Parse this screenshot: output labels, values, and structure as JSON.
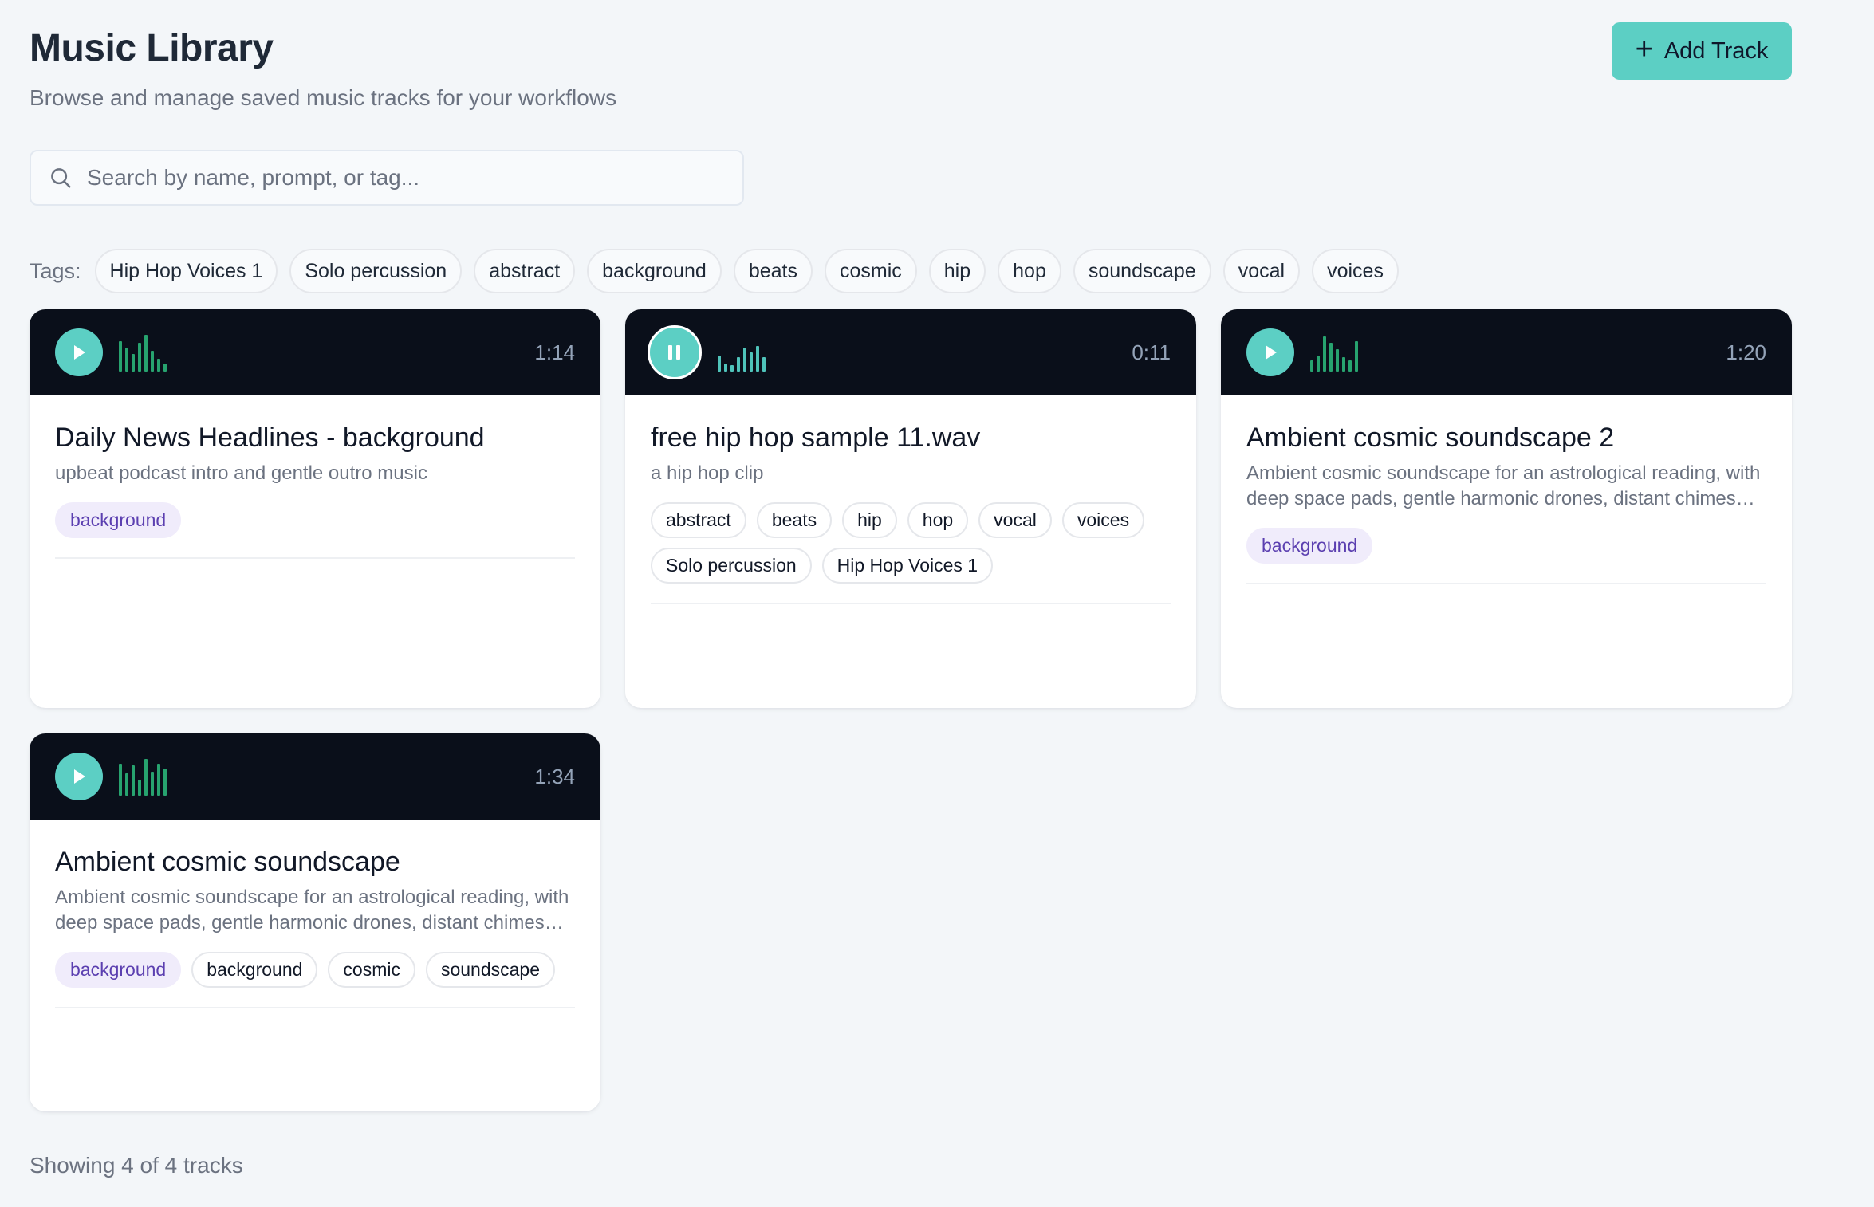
{
  "header": {
    "title": "Music Library",
    "subtitle": "Browse and manage saved music tracks for your workflows",
    "add_label": "Add Track"
  },
  "search": {
    "placeholder": "Search by name, prompt, or tag...",
    "value": ""
  },
  "tags": {
    "label": "Tags:",
    "items": [
      "Hip Hop Voices 1",
      "Solo percussion",
      "abstract",
      "background",
      "beats",
      "cosmic",
      "hip",
      "hop",
      "soundscape",
      "vocal",
      "voices"
    ]
  },
  "tracks": [
    {
      "name": "Daily News Headlines - background",
      "description": "upbeat podcast intro and gentle outro music",
      "duration": "1:14",
      "state": "paused",
      "primary_tag": "background",
      "tags": []
    },
    {
      "name": "free hip hop sample 11.wav",
      "description": "a hip hop clip",
      "duration": "0:11",
      "state": "playing",
      "primary_tag": "",
      "tags": [
        "abstract",
        "beats",
        "hip",
        "hop",
        "vocal",
        "voices",
        "Solo percussion",
        "Hip Hop Voices 1"
      ]
    },
    {
      "name": "Ambient cosmic soundscape 2",
      "description": "Ambient cosmic soundscape for an astrological reading, with deep space pads, gentle harmonic drones, distant chimes and subtle shimmer",
      "duration": "1:20",
      "state": "paused",
      "primary_tag": "background",
      "tags": []
    },
    {
      "name": "Ambient cosmic soundscape",
      "description": "Ambient cosmic soundscape for an astrological reading, with deep space pads, gentle harmonic drones, distant chimes and subtle shimmer",
      "duration": "1:34",
      "state": "paused",
      "primary_tag": "background",
      "tags": [
        "background",
        "cosmic",
        "soundscape"
      ]
    }
  ],
  "footer": {
    "summary": "Showing 4 of 4 tracks"
  },
  "icons": {
    "add": "plus-icon",
    "search": "search-icon",
    "play": "play-icon",
    "pause": "pause-icon",
    "waveform": "waveform-icon"
  },
  "colors": {
    "accent": "#5ccfc4",
    "card_header": "#0a0f1a",
    "wave_green": "#27a36f",
    "wave_teal": "#4fc3ba",
    "primary_chip_bg": "#f0ecfb",
    "primary_chip_text": "#5b3fb0"
  }
}
